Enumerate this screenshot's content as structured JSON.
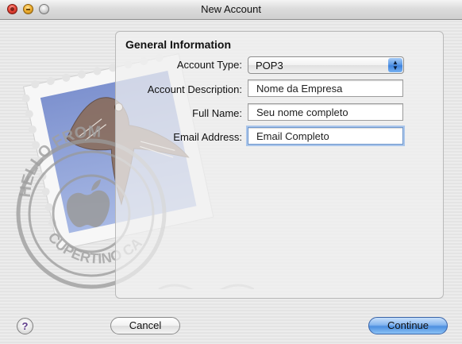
{
  "window": {
    "title": "New Account"
  },
  "section": {
    "title": "General Information"
  },
  "fields": {
    "account_type": {
      "label": "Account Type:",
      "value": "POP3"
    },
    "account_description": {
      "label": "Account Description:",
      "value": "Nome da Empresa"
    },
    "full_name": {
      "label": "Full Name:",
      "value": "Seu nome completo"
    },
    "email_address": {
      "label": "Email Address:",
      "value": "Email Completo"
    }
  },
  "stamp": {
    "postmark_top": "HELLO FROM",
    "postmark_bottom": "CUPERTINO CA"
  },
  "buttons": {
    "help": "?",
    "cancel": "Cancel",
    "continue": "Continue"
  },
  "colors": {
    "accent": "#4d8fe0",
    "focus_ring": "#a9c5ea"
  }
}
